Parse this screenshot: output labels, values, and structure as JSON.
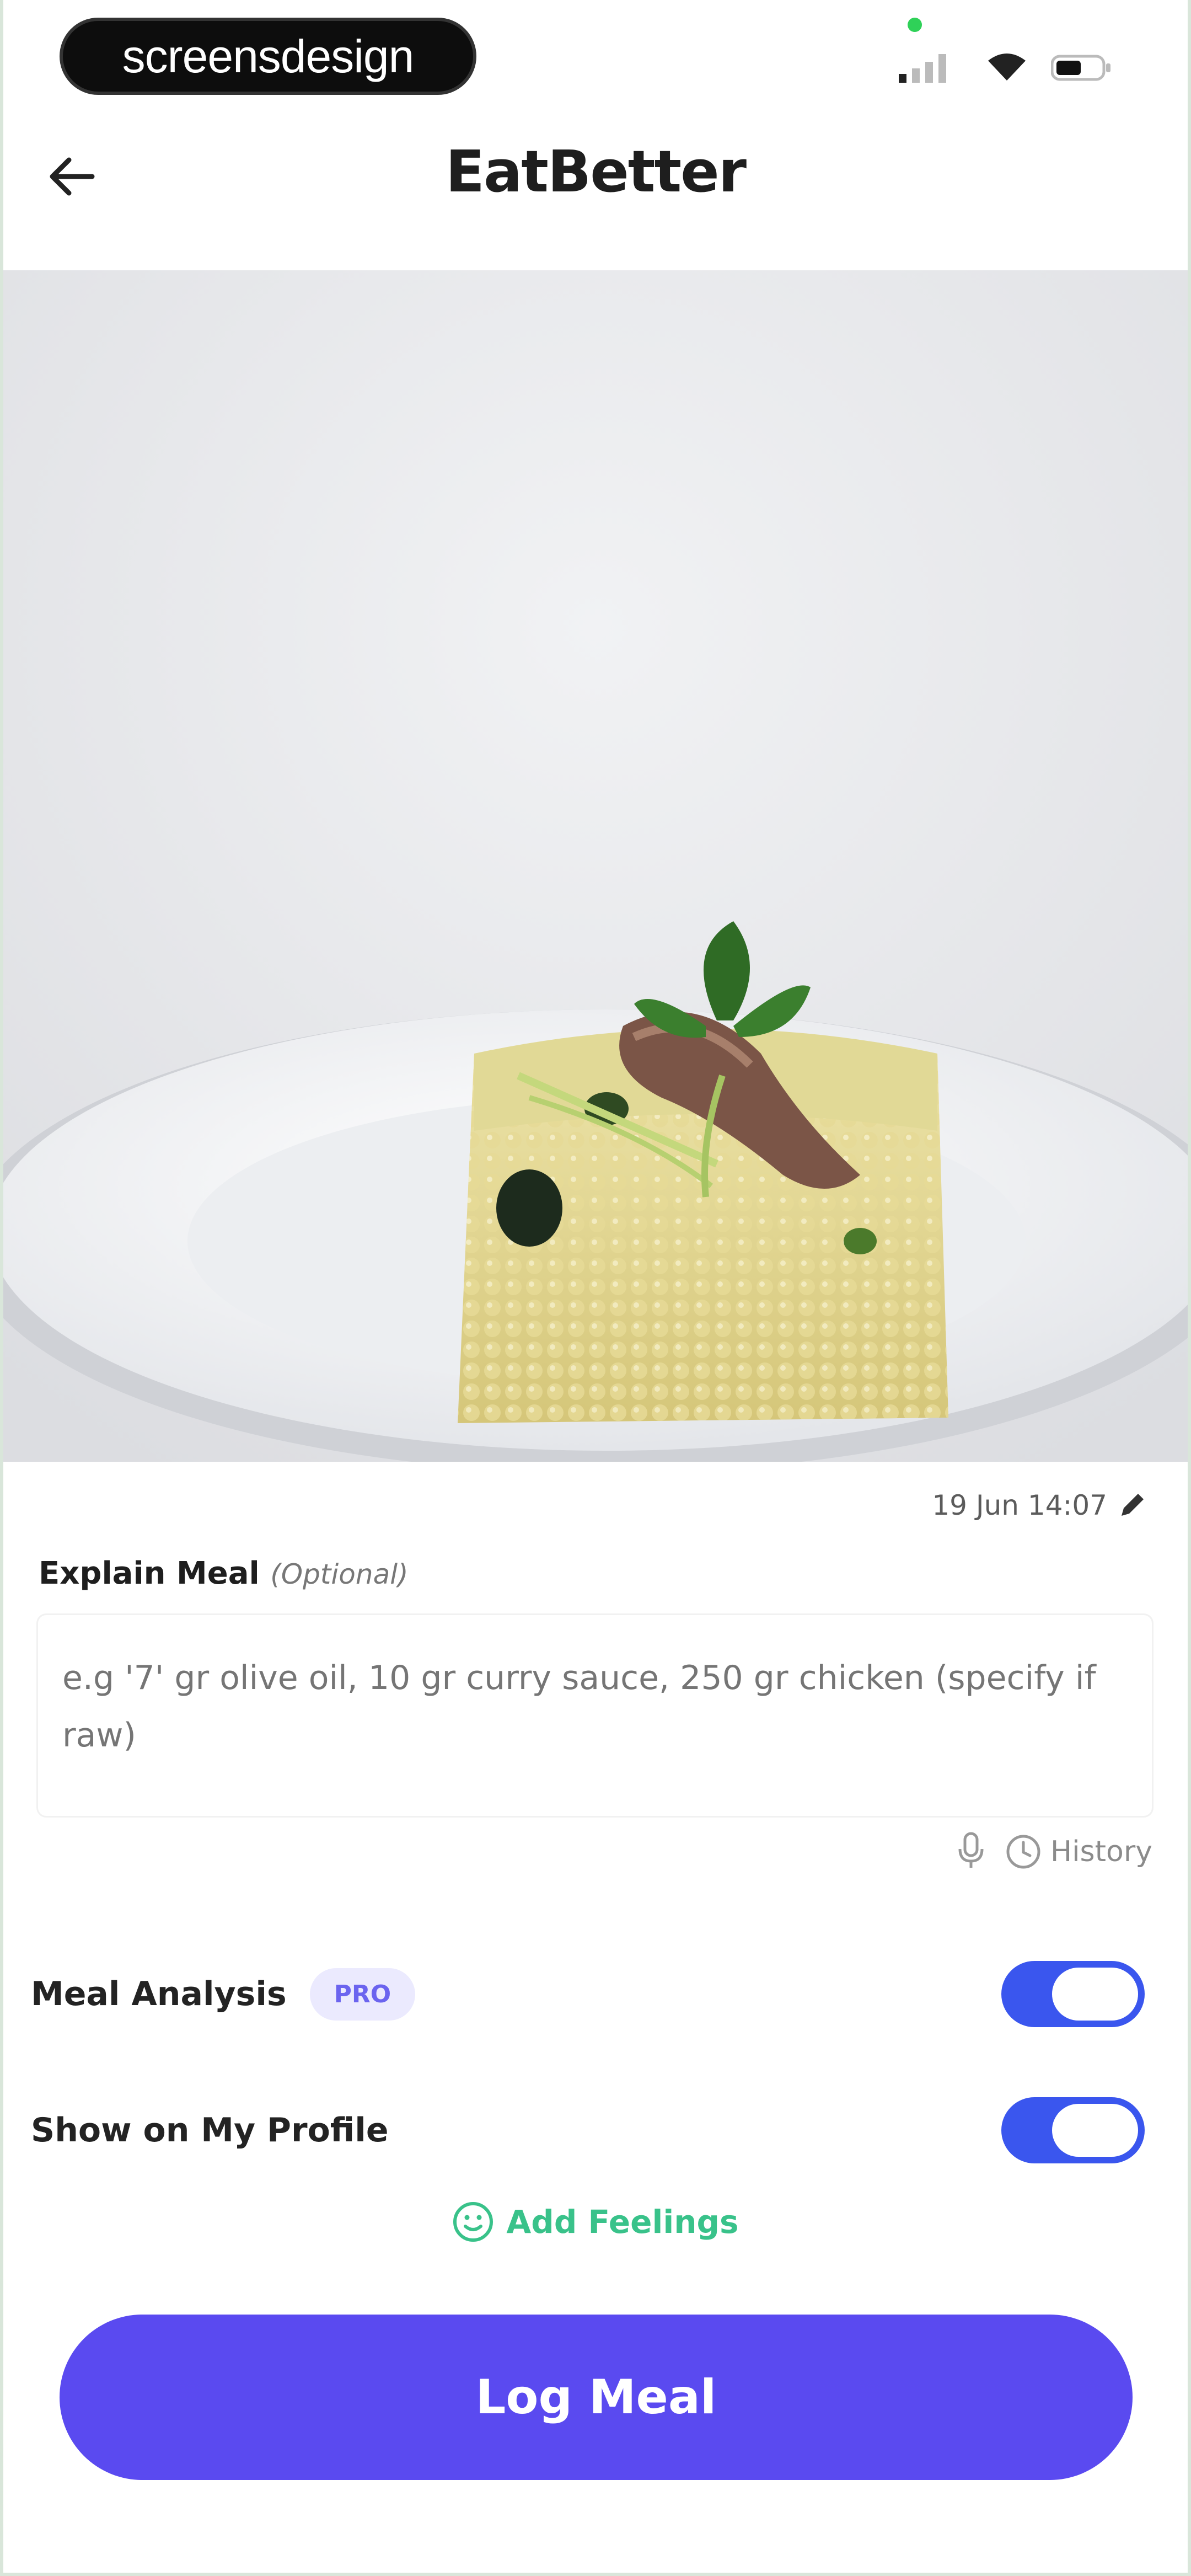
{
  "badge": {
    "text": "screensdesign"
  },
  "header": {
    "title": "EatBetter"
  },
  "photo": {
    "description_icon": "meal-photo"
  },
  "meta": {
    "datetime": "19 Jun 14:07"
  },
  "explain": {
    "label": "Explain Meal",
    "optional": "(Optional)",
    "placeholder": "e.g '7' gr olive oil, 10 gr curry sauce, 250 gr chicken (specify if raw)"
  },
  "tools": {
    "history_label": "History"
  },
  "toggles": {
    "meal_analysis": {
      "label": "Meal Analysis",
      "badge": "PRO",
      "on": true
    },
    "show_profile": {
      "label": "Show on My Profile",
      "on": true
    }
  },
  "feelings": {
    "label": "Add Feelings"
  },
  "cta": {
    "label": "Log Meal"
  },
  "colors": {
    "accent": "#5a4af0",
    "toggle_on": "#3a56ee",
    "feelings_green": "#39c28a",
    "pro_bg": "#ebeafe"
  }
}
